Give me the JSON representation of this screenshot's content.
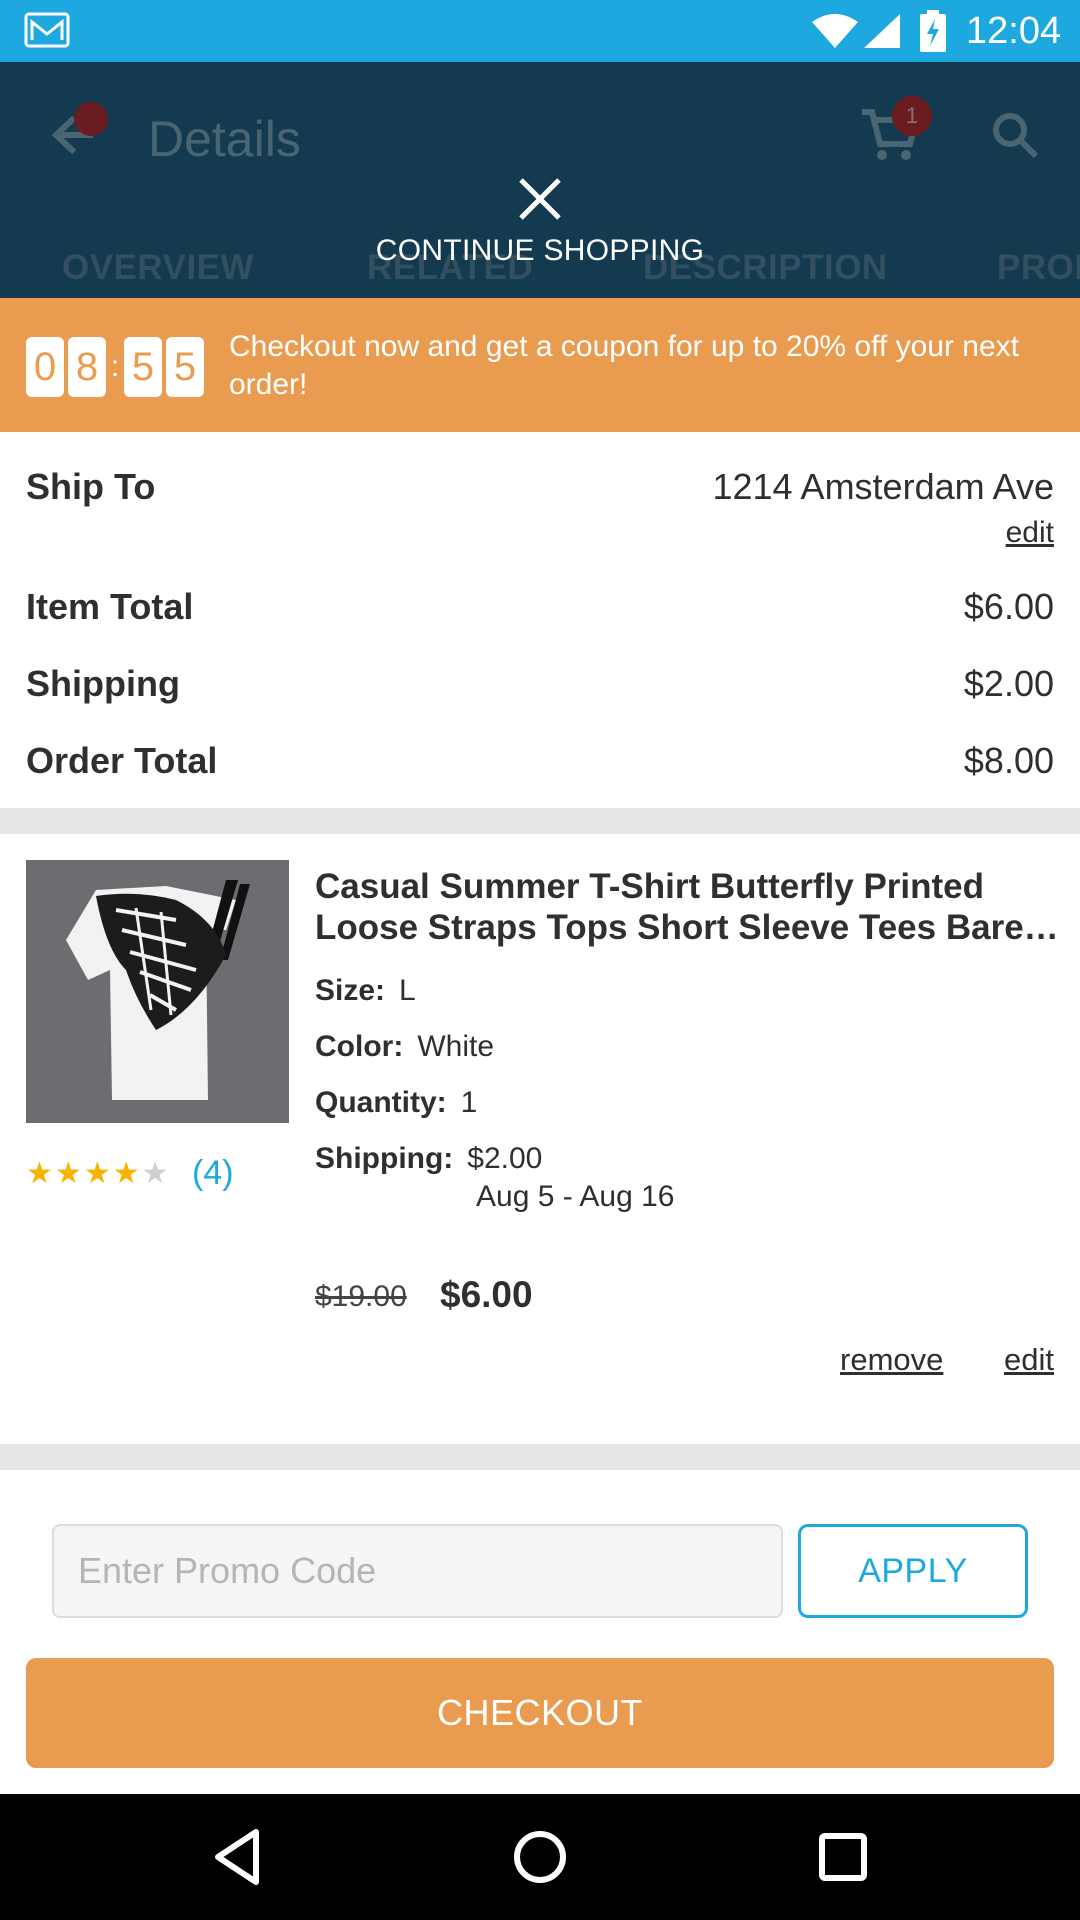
{
  "status_bar": {
    "time": "12:04",
    "icons": [
      "gmail-icon",
      "wifi-icon",
      "signal-icon",
      "battery-charging-icon"
    ]
  },
  "app_bar": {
    "title": "Details",
    "cart_count": "1",
    "tabs": [
      "OVERVIEW",
      "RELATED",
      "DESCRIPTION",
      "PROD"
    ]
  },
  "overlay": {
    "close_label": "CONTINUE SHOPPING"
  },
  "promo_banner": {
    "timer_digits": [
      "0",
      "8",
      "5",
      "5"
    ],
    "message": "Checkout now and get a coupon for up to 20% off your next order!",
    "color": "#e99c4f"
  },
  "summary": {
    "ship_to_label": "Ship To",
    "ship_to_value": "1214 Amsterdam Ave",
    "edit_label": "edit",
    "item_total_label": "Item Total",
    "item_total_value": "$6.00",
    "shipping_label": "Shipping",
    "shipping_value": "$2.00",
    "order_total_label": "Order Total",
    "order_total_value": "$8.00"
  },
  "product": {
    "title_line1": "Casual Summer T-Shirt Butterfly Printed",
    "title_line2": "Loose Straps Tops Short Sleeve Tees Bare…",
    "rating": 4,
    "rating_max": 5,
    "review_count": "(4)",
    "size_label": "Size:",
    "size_value": "L",
    "color_label": "Color:",
    "color_value": "White",
    "quantity_label": "Quantity:",
    "quantity_value": "1",
    "shipping_label": "Shipping:",
    "shipping_value": "$2.00",
    "shipping_dates": "Aug 5 - Aug 16",
    "original_price": "$19.00",
    "price": "$6.00",
    "remove_label": "remove",
    "edit_label": "edit"
  },
  "promo_code": {
    "placeholder": "Enter Promo Code",
    "value": "",
    "apply_label": "APPLY"
  },
  "checkout": {
    "label": "CHECKOUT"
  },
  "colors": {
    "status_bar": "#1da8df",
    "app_bar": "#133a4f",
    "accent_orange": "#e99c4f",
    "accent_blue": "#1da8df"
  }
}
